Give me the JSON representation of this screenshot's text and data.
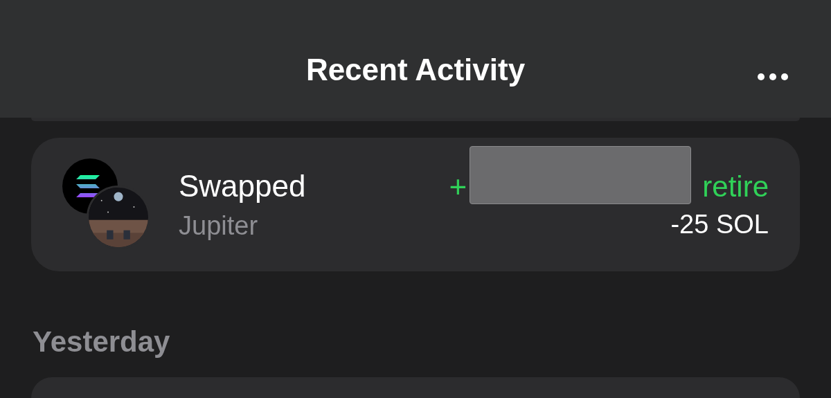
{
  "header": {
    "title": "Recent Activity"
  },
  "activities": [
    {
      "title": "Swapped",
      "subtitle": "Jupiter",
      "received_sign": "+",
      "received_token": "retire",
      "received_redacted": true,
      "sent": "-25 SOL"
    }
  ],
  "sections": [
    {
      "title": "Yesterday"
    }
  ]
}
